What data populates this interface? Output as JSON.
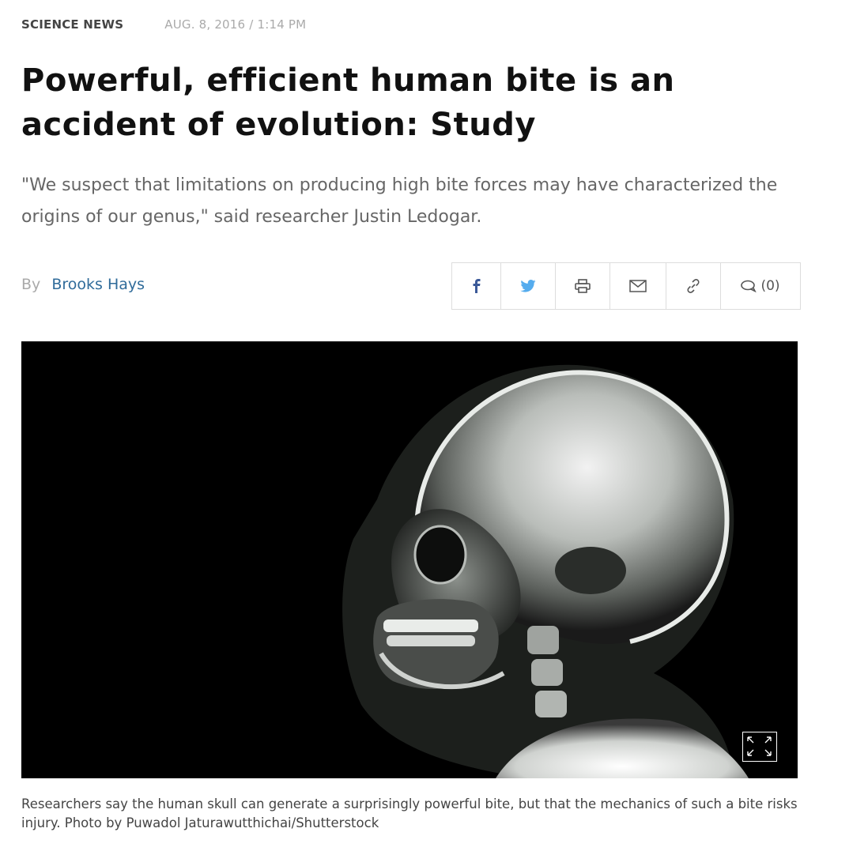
{
  "meta": {
    "section": "SCIENCE NEWS",
    "date": "AUG. 8, 2016 / 1:14 PM"
  },
  "article": {
    "headline": "Powerful, efficient human bite is an accident of evolution: Study",
    "dek": "\"We suspect that limitations on producing high bite forces may have characterized the origins of our genus,\" said researcher Justin Ledogar.",
    "byline_prefix": "By",
    "author": "Brooks Hays"
  },
  "share": {
    "icons": [
      "facebook-icon",
      "twitter-icon",
      "print-icon",
      "email-icon",
      "link-icon",
      "comment-icon"
    ],
    "comment_count": "(0)"
  },
  "photo": {
    "caption": "Researchers say the human skull can generate a surprisingly powerful bite, but that the mechanics of such a bite risks injury. Photo by Puwadol Jaturawutthichai/Shutterstock",
    "expand_icon": "expand-icon"
  },
  "colors": {
    "author_link": "#2f6b9a",
    "twitter": "#55acee",
    "facebook": "#3b5998"
  }
}
